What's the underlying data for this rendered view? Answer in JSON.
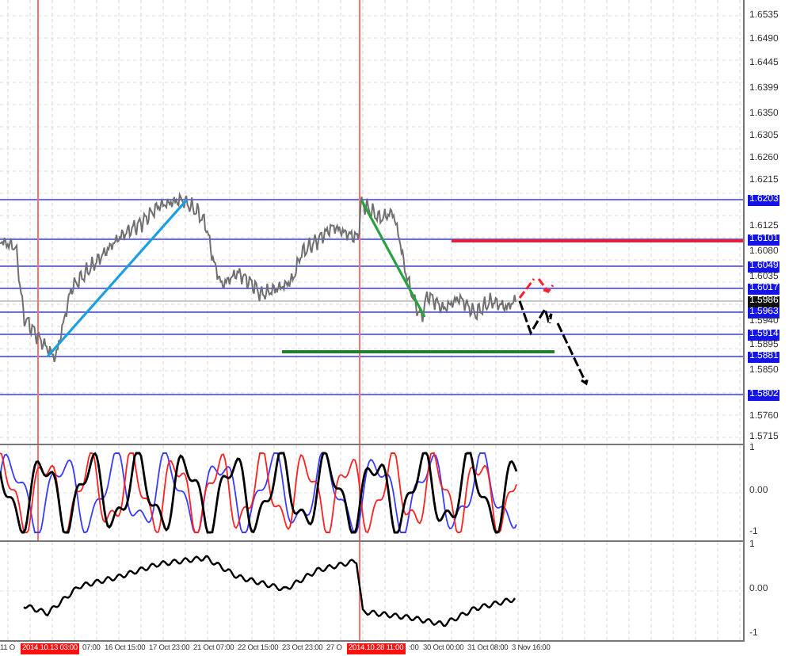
{
  "price_axis": [
    {
      "label": "1.6535",
      "kind": "tick"
    },
    {
      "label": "1.6490",
      "kind": "tick"
    },
    {
      "label": "1.6445",
      "kind": "tick"
    },
    {
      "label": "1.6399",
      "kind": "tick"
    },
    {
      "label": "1.6350",
      "kind": "tick"
    },
    {
      "label": "1.6305",
      "kind": "tick"
    },
    {
      "label": "1.6260",
      "kind": "tick"
    },
    {
      "label": "1.6215",
      "kind": "tick"
    },
    {
      "label": "1.6203",
      "kind": "level"
    },
    {
      "label": "1.6125",
      "kind": "tick"
    },
    {
      "label": "1.6101",
      "kind": "level"
    },
    {
      "label": "1.6080",
      "kind": "tick"
    },
    {
      "label": "1.6049",
      "kind": "level"
    },
    {
      "label": "1.6035",
      "kind": "tick"
    },
    {
      "label": "1.6017",
      "kind": "level"
    },
    {
      "label": "1.5986",
      "kind": "current"
    },
    {
      "label": "1.5963",
      "kind": "level"
    },
    {
      "label": "1.5940",
      "kind": "tick"
    },
    {
      "label": "1.5914",
      "kind": "level"
    },
    {
      "label": "1.5895",
      "kind": "tick"
    },
    {
      "label": "1.5881",
      "kind": "level"
    },
    {
      "label": "1.5850",
      "kind": "tick"
    },
    {
      "label": "1.5802",
      "kind": "level"
    },
    {
      "label": "1.5760",
      "kind": "tick"
    },
    {
      "label": "1.5715",
      "kind": "tick"
    }
  ],
  "indicator_1": {
    "scale": [
      "1",
      "0.00",
      "-1"
    ]
  },
  "indicator_2": {
    "scale": [
      "1",
      "0.00",
      "-1"
    ]
  },
  "time_axis": [
    {
      "label": "11 O",
      "kind": "tick"
    },
    {
      "label": "2014.10.13 03:00",
      "kind": "marker"
    },
    {
      "label": "07:00",
      "kind": "tick"
    },
    {
      "label": "16 Oct 15:00",
      "kind": "tick"
    },
    {
      "label": "17 Oct 23:00",
      "kind": "tick"
    },
    {
      "label": "21 Oct 07:00",
      "kind": "tick"
    },
    {
      "label": "22 Oct 15:00",
      "kind": "tick"
    },
    {
      "label": "23 Oct 23:00",
      "kind": "tick"
    },
    {
      "label": "27 O",
      "kind": "tick"
    },
    {
      "label": "2014.10.28 11:00",
      "kind": "marker"
    },
    {
      "label": ":00",
      "kind": "tick"
    },
    {
      "label": "30 Oct 00:00",
      "kind": "tick"
    },
    {
      "label": "31 Oct 08:00",
      "kind": "tick"
    },
    {
      "label": "3 Nov 16:00",
      "kind": "tick"
    }
  ]
}
